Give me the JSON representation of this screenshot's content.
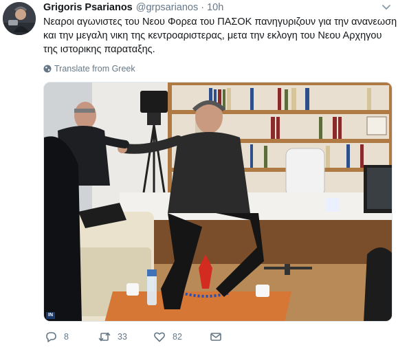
{
  "tweet": {
    "author_name": "Grigoris Psarianos",
    "author_handle": "@grpsarianos",
    "separator": "·",
    "timestamp": "10h",
    "text_lines": [
      "Νεαροι αγωνιστες του Νεου Φορεα του ΠΑΣΟΚ πανηγυριζουν για την ανανεωση",
      "και την μεγαλη νικη της κεντροαριστερας, μετα την εκλογη του Νεου Αρχηγου",
      "της ιστορικης παραταξης."
    ],
    "translate_label": "Translate from Greek",
    "media_watermark": "IN",
    "reply_count": "8",
    "retweet_count": "33",
    "like_count": "82"
  },
  "icons": {
    "caret": "chevron-down-icon",
    "translate": "globe-icon",
    "reply": "reply-icon",
    "retweet": "retweet-icon",
    "like": "heart-icon",
    "message": "envelope-icon"
  },
  "colors": {
    "text": "#14171a",
    "muted": "#657786",
    "border": "#e1e8ed",
    "background": "#ffffff"
  }
}
